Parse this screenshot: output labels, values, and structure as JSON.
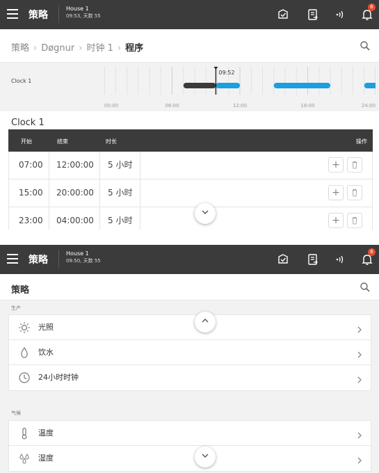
{
  "screen1": {
    "topbar": {
      "title": "策略",
      "house_name": "House 1",
      "house_info": "09:53, 天数 55",
      "alarm_count": "6"
    },
    "breadcrumb": {
      "items": [
        "策略",
        "Døgnur",
        "时钟 1"
      ],
      "current": "程序"
    },
    "timeline": {
      "label": "Clock 1",
      "marker_time": "09:52",
      "ticks": [
        "00:00",
        "06:00",
        "12:00",
        "18:00",
        "24:00"
      ],
      "range_hours": [
        0,
        24
      ],
      "now_hours": 9.87,
      "colors": {
        "past": "#3b3b3b",
        "future": "#1a9fe0"
      },
      "periods": [
        {
          "start": 7,
          "end": 12
        },
        {
          "start": 15,
          "end": 20
        },
        {
          "start": 23,
          "end": 28
        }
      ]
    },
    "section_title": "Clock 1",
    "table": {
      "headers": {
        "start": "开始",
        "end": "结束",
        "duration": "时长",
        "actions": "操作"
      },
      "rows": [
        {
          "start": "07:00",
          "end": "12:00:00",
          "duration": "5 小时"
        },
        {
          "start": "15:00",
          "end": "20:00:00",
          "duration": "5 小时"
        },
        {
          "start": "23:00",
          "end": "04:00:00",
          "duration": "5 小时"
        }
      ],
      "add_symbol": "+"
    }
  },
  "screen2": {
    "topbar": {
      "title": "策略",
      "house_name": "House 1",
      "house_info": "09:50, 天数 55",
      "alarm_count": "6"
    },
    "page_title": "策略",
    "groups": [
      {
        "name": "生产",
        "items": [
          {
            "label": "光照",
            "icon": "light-icon"
          },
          {
            "label": "饮水",
            "icon": "water-drop-icon"
          },
          {
            "label": "24小时时钟",
            "icon": "clock-icon"
          }
        ]
      },
      {
        "name": "气候",
        "items": [
          {
            "label": "温度",
            "icon": "thermometer-icon"
          },
          {
            "label": "湿度",
            "icon": "humidity-icon"
          }
        ]
      }
    ]
  }
}
